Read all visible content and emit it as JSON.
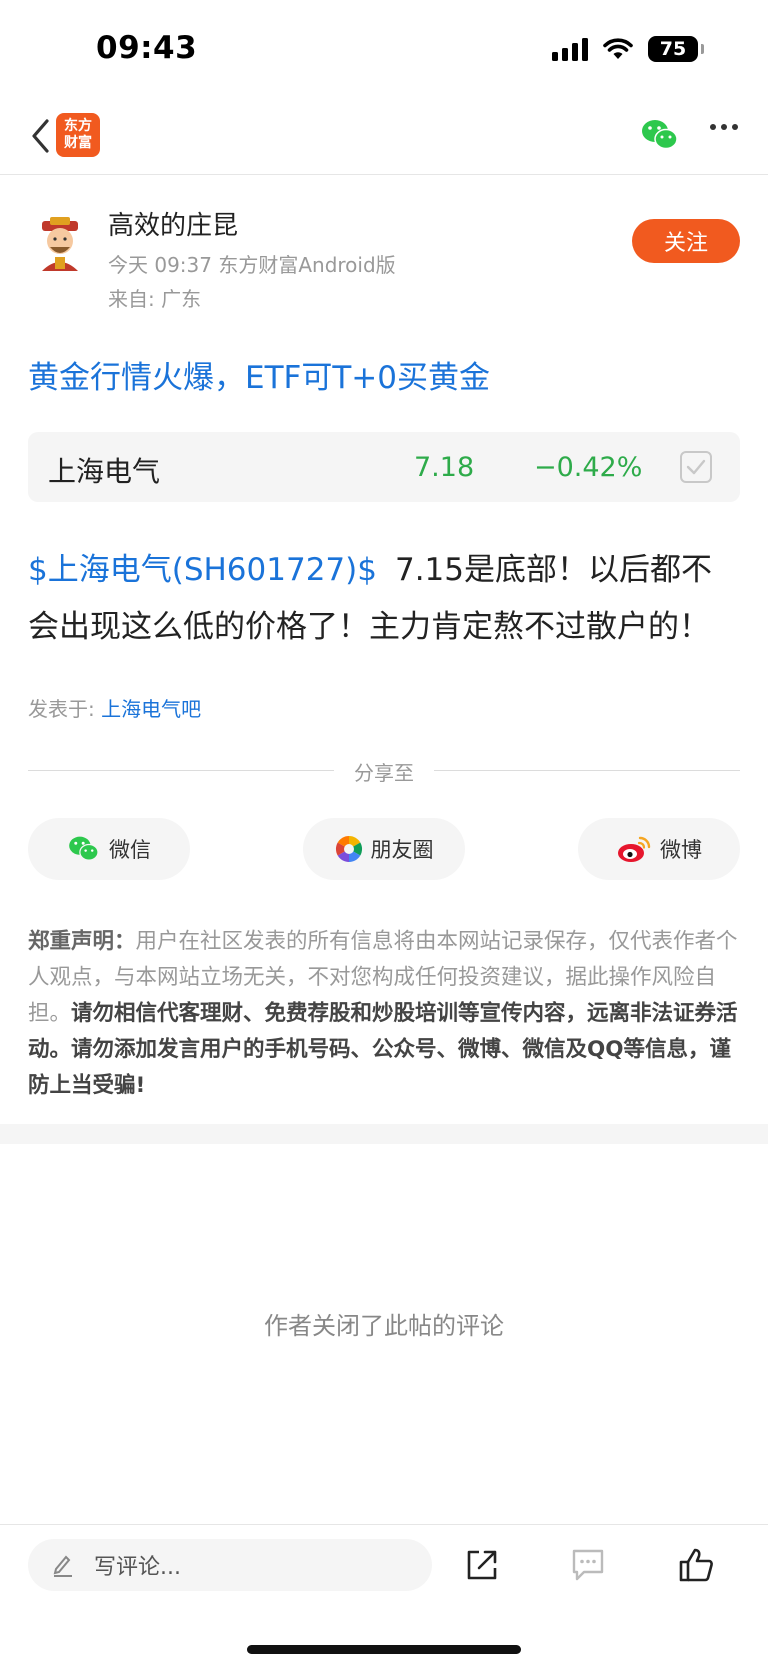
{
  "status_bar": {
    "time": "09:43",
    "battery": "75"
  },
  "nav": {
    "logo_line1": "东方",
    "logo_line2": "财富"
  },
  "author": {
    "name": "高效的庄昆",
    "meta": "今天 09:37 东方财富Android版",
    "from": "来自: 广东",
    "follow_label": "关注"
  },
  "post": {
    "title": "黄金行情火爆，ETF可T+0买黄金",
    "stock_card": {
      "name": "上海电气",
      "price": "7.18",
      "change": "−0.42%"
    },
    "body_link": "$上海电气(SH601727)$",
    "body_text": "7.15是底部！以后都不会出现这么低的价格了！主力肯定熬不过散户的！",
    "posted_in_label": "发表于:",
    "posted_in_bar": "上海电气吧"
  },
  "share": {
    "label": "分享至",
    "buttons": [
      {
        "label": "微信",
        "icon": "wechat-icon"
      },
      {
        "label": "朋友圈",
        "icon": "moments-icon"
      },
      {
        "label": "微博",
        "icon": "weibo-icon"
      }
    ]
  },
  "disclaimer": {
    "heading": "郑重声明：",
    "normal": "用户在社区发表的所有信息将由本网站记录保存，仅代表作者个人观点，与本网站立场无关，不对您构成任何投资建议，据此操作风险自担。",
    "bold": "请勿相信代客理财、免费荐股和炒股培训等宣传内容，远离非法证券活动。请勿添加发言用户的手机号码、公众号、微博、微信及QQ等信息，谨防上当受骗!"
  },
  "comments_closed": "作者关闭了此帖的评论",
  "bottom_bar": {
    "comment_placeholder": "写评论...",
    "icons": [
      "pencil-icon",
      "share-out-icon",
      "comment-icon",
      "thumbs-up-icon"
    ]
  },
  "colors": {
    "accent": "#f15a1f",
    "link": "#1a73d9",
    "stock_down": "#2eab4a",
    "muted": "#999999"
  }
}
